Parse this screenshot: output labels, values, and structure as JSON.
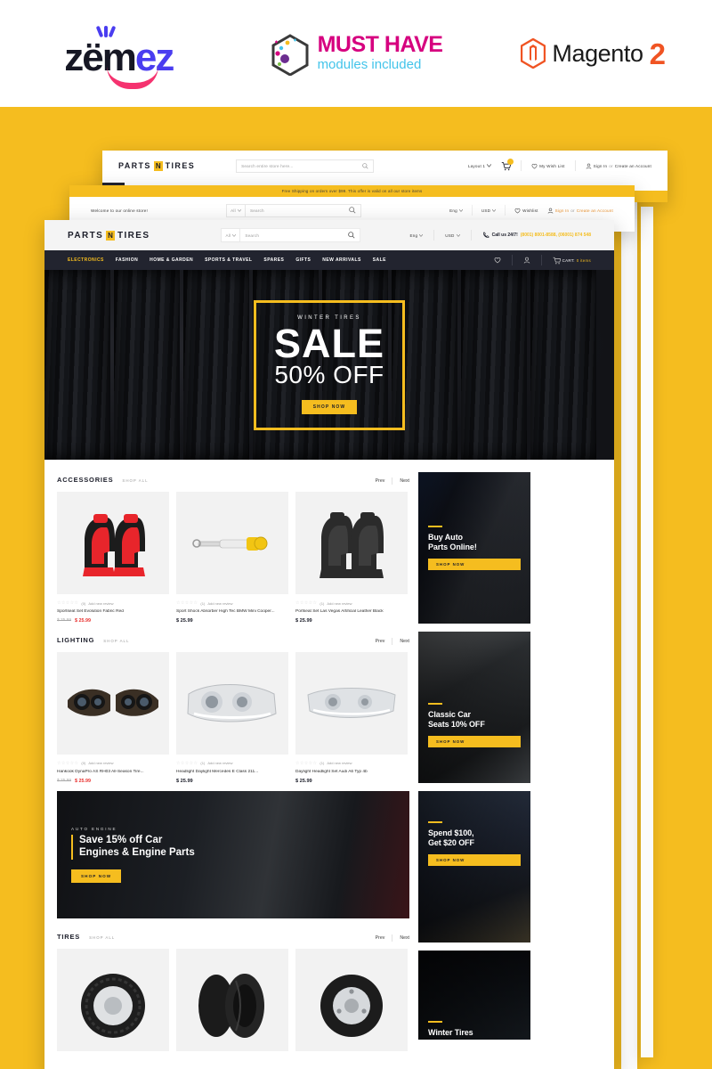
{
  "brandbar": {
    "zemez": {
      "part1": "z",
      "accent1": "ëm",
      "part2": "e",
      "part3": "z",
      "full": "zemez"
    },
    "musthave": {
      "title": "MUST HAVE",
      "subtitle": "modules included"
    },
    "magento": {
      "name": "Magento",
      "version": "2"
    }
  },
  "colors": {
    "yellow": "#f5bd1f",
    "dark": "#22242f",
    "red": "#e8312f",
    "pink": "#f5326f",
    "blue": "#4a3df0",
    "magenta": "#d6007f",
    "cyan": "#43c4ea",
    "orange": "#f05423"
  },
  "window1": {
    "logo": {
      "left": "PARTS",
      "badge": "N",
      "right": "TIRES"
    },
    "search_placeholder": "Search entire store here...",
    "layout_select": "Layout 1",
    "wishlist": "My Wish List",
    "signin": "Sign In",
    "or": "or",
    "create_account": "Create an Account",
    "shipping_note": "Free Shipping on orders over $99. This offer is valid on all our store items"
  },
  "window2": {
    "shipping_note": "Free Shipping on orders over $99. This offer is valid on all our store items",
    "welcome": "Welcome to our online store!",
    "category_select": "All",
    "search_placeholder": "Search",
    "lang_select": "Eng",
    "currency_select": "USD",
    "wishlist": "Wishlist",
    "signin": "Sign In",
    "or": "or",
    "create_account": "Create an Account"
  },
  "store": {
    "logo": {
      "left": "PARTS",
      "badge": "N",
      "right": "TIRES"
    },
    "category_select": "All",
    "search_placeholder": "Search",
    "lang_select": "Eng",
    "currency_select": "USD",
    "call_label": "Call us 24/7!",
    "call_numbers": "(8001) 8001-8588, (06001) 874 548",
    "nav": [
      {
        "label": "ELECTRONICS",
        "active": true
      },
      {
        "label": "FASHION",
        "active": false
      },
      {
        "label": "HOME & GARDEN",
        "active": false
      },
      {
        "label": "SPORTS & TRAVEL",
        "active": false
      },
      {
        "label": "SPARES",
        "active": false
      },
      {
        "label": "GIFTS",
        "active": false
      },
      {
        "label": "NEW ARRIVALS",
        "active": false
      },
      {
        "label": "SALE",
        "active": false
      }
    ],
    "cart_label": "CART:",
    "cart_count": "0 items"
  },
  "hero": {
    "kicker": "WINTER TIRES",
    "headline": "SALE",
    "subhead": "50% OFF",
    "button": "SHOP NOW"
  },
  "sections": [
    {
      "title": "ACCESSORIES",
      "shop_all": "SHOP ALL",
      "prev": "Prev",
      "next": "Next",
      "products": [
        {
          "name": "Sportseat Set Evolution Fabric Red",
          "rating_count": "(0)",
          "add_review": "Add new review",
          "old_price": "$ 25.99",
          "new_price": "$ 25.99",
          "on_sale": true,
          "thumb": "car-seats-red"
        },
        {
          "name": "Sport Shock Absorber High Tec BMW Mini Cooper...",
          "rating_count": "(1)",
          "add_review": "Add new review",
          "old_price": "",
          "new_price": "$ 25.99",
          "on_sale": false,
          "thumb": "shock-absorber"
        },
        {
          "name": "Portseat Set Las Vegas Artificial Leather Black",
          "rating_count": "(1)",
          "add_review": "Add new review",
          "old_price": "",
          "new_price": "$ 25.99",
          "on_sale": false,
          "thumb": "car-seats-black"
        }
      ]
    },
    {
      "title": "LIGHTING",
      "shop_all": "SHOP ALL",
      "prev": "Prev",
      "next": "Next",
      "products": [
        {
          "name": "Hankook DynaPro AS RH03 All-Season Tire...",
          "rating_count": "(0)",
          "add_review": "Add new review",
          "old_price": "$ 25.99",
          "new_price": "$ 25.99",
          "on_sale": true,
          "thumb": "headlights-pair"
        },
        {
          "name": "Headlight Daylight Mercedes E Class 211...",
          "rating_count": "(1)",
          "add_review": "Add new review",
          "old_price": "",
          "new_price": "$ 25.99",
          "on_sale": false,
          "thumb": "headlight-mercedes"
        },
        {
          "name": "Daylight Headlight Set Audi A6 Typ 4b",
          "rating_count": "(1)",
          "add_review": "Add new review",
          "old_price": "",
          "new_price": "$ 25.99",
          "on_sale": false,
          "thumb": "headlight-audi"
        }
      ]
    },
    {
      "title": "TIRES",
      "shop_all": "SHOP ALL",
      "prev": "Prev",
      "next": "Next",
      "products": [
        {
          "name": "",
          "rating_count": "",
          "add_review": "",
          "old_price": "",
          "new_price": "",
          "on_sale": false,
          "thumb": "tire-1"
        },
        {
          "name": "",
          "rating_count": "",
          "add_review": "",
          "old_price": "",
          "new_price": "",
          "on_sale": false,
          "thumb": "tire-2"
        },
        {
          "name": "",
          "rating_count": "",
          "add_review": "",
          "old_price": "",
          "new_price": "",
          "on_sale": false,
          "thumb": "tire-3"
        }
      ]
    }
  ],
  "wide_banner": {
    "kicker": "AUTO ENGINE",
    "title_line1": "Save 15% off Car",
    "title_line2": "Engines & Engine Parts",
    "button": "SHOP NOW"
  },
  "side_banners": [
    {
      "title_line1": "Buy Auto",
      "title_line2": "Parts Online!",
      "button": "SHOP NOW",
      "theme": "b-engine"
    },
    {
      "title_line1": "Classic Car",
      "title_line2": "Seats 10% OFF",
      "button": "SHOP NOW",
      "theme": "b-seat"
    },
    {
      "title_line1": "Spend $100,",
      "title_line2": "Get $20 OFF",
      "button": "SHOP NOW",
      "theme": "b-battery"
    },
    {
      "title_line1": "Winter Tires",
      "title_line2": "",
      "button": "",
      "theme": "b-winter"
    }
  ]
}
